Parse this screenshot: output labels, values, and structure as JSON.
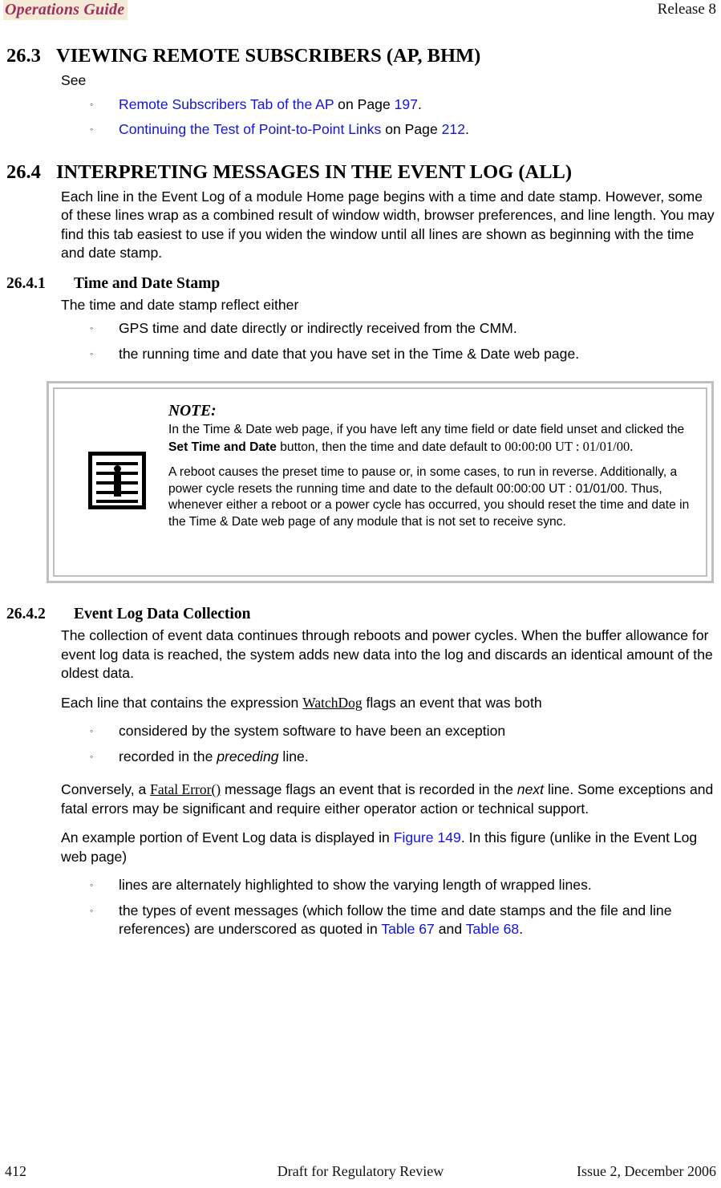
{
  "header": {
    "title": "Operations Guide",
    "release": "Release 8",
    "title_bg": "#f4ead6",
    "title_color": "#9c2f62"
  },
  "link_color": "#1414d6",
  "sections": {
    "s263": {
      "number": "26.3",
      "title": "VIEWING REMOTE SUBSCRIBERS (AP, BHM)",
      "intro": "See",
      "bullets": [
        {
          "link": "Remote Subscribers Tab of the AP",
          "mid": " on Page ",
          "page": "197",
          "end": "."
        },
        {
          "link": "Continuing the Test of Point-to-Point Links",
          "mid": " on Page ",
          "page": "212",
          "end": "."
        }
      ]
    },
    "s264": {
      "number": "26.4",
      "title": "INTERPRETING MESSAGES IN THE EVENT LOG (ALL)",
      "para": "Each line in the Event Log of a module Home page begins with a time and date stamp. However, some of these lines wrap as a combined result of window width, browser preferences, and line length. You may find this tab easiest to use if you widen the window until all lines are shown as beginning with the time and date stamp."
    },
    "s2641": {
      "number": "26.4.1",
      "title": "Time and Date Stamp",
      "para": "The time and date stamp reflect either",
      "bullets": [
        "GPS time and date directly or indirectly received from the CMM.",
        "the running time and date that you have set in the Time & Date web page."
      ]
    },
    "s2642": {
      "number": "26.4.2",
      "title": "Event Log Data Collection",
      "para1": "The collection of event data continues through reboots and power cycles. When the buffer allowance for event log data is reached, the system adds new data into the log and discards an identical amount of the oldest data.",
      "para2_pre": "Each line that contains the expression ",
      "para2_code": "WatchDog",
      "para2_post": " flags an event that was both",
      "bullets2": [
        {
          "pre": "considered by the system software to have been an exception",
          "ital": "",
          "post": ""
        },
        {
          "pre": "recorded in the ",
          "ital": "preceding",
          "post": " line."
        }
      ],
      "para3_pre": "Conversely, a ",
      "para3_code": "Fatal Error()",
      "para3_mid": " message flags an event that is recorded in the ",
      "para3_ital": "next",
      "para3_post": " line. Some exceptions and fatal errors may be significant and require either operator action or technical support.",
      "para4_pre": "An example portion of Event Log data is displayed in ",
      "para4_link": "Figure 149",
      "para4_post": ". In this figure (unlike in the Event Log web page)",
      "bullets3": [
        {
          "text": "lines are alternately highlighted to show the varying length of wrapped lines."
        }
      ],
      "bullet3_last": {
        "pre": "the types of event messages (which follow the time and date stamps and the file and line references) are underscored as quoted in ",
        "link1": "Table 67",
        "mid": " and ",
        "link2": "Table 68",
        "post": "."
      }
    }
  },
  "note": {
    "icon": "note-info-icon",
    "title": "NOTE:",
    "p1_a": "In the Time & Date web page, if you have left any time field or date field unset and clicked the ",
    "p1_bold": "Set Time and Date",
    "p1_b": " button, then the time and date default to ",
    "p1_mono": "00:00:00 UT : 01/01/00",
    "p1_c": ".",
    "p2": "A reboot causes the preset time to pause or, in some cases, to run in reverse. Additionally, a power cycle resets the running time and date to the default 00:00:00 UT : 01/01/00. Thus, whenever either a reboot or a power cycle has occurred, you should reset the time and date in the Time & Date web page of any module that is not set to receive sync."
  },
  "footer": {
    "page_number": "412",
    "center": "Draft for Regulatory Review",
    "right": "Issue 2, December 2006"
  }
}
